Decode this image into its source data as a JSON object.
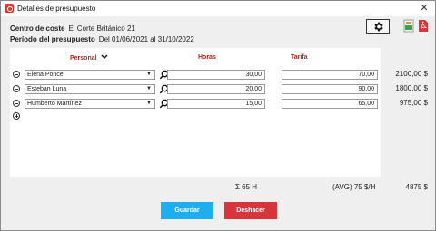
{
  "window": {
    "title": "Detalles de presupuesto"
  },
  "info": {
    "cost_center_label": "Centro de coste",
    "cost_center_value": "El Corte Británico 21",
    "period_label": "Período del presupuesto",
    "period_value": "Del 01/06/2021 al 31/10/2022"
  },
  "toolbar": {
    "settings_icon": "gear-icon",
    "export_icons": [
      "excel-export-icon",
      "pdf-export-icon"
    ]
  },
  "table": {
    "headers": {
      "person": "Personal",
      "hours": "Horas",
      "rate": "Tarifa"
    },
    "rows": [
      {
        "person": "Elena Ponce",
        "hours": "30,00",
        "rate": "70,00",
        "total": "2100,00 $"
      },
      {
        "person": "Esteban Luna",
        "hours": "20,00",
        "rate": "90,00",
        "total": "1800,00 $"
      },
      {
        "person": "Humberto Martínez",
        "hours": "15,00",
        "rate": "65,00",
        "total": "975,00 $"
      }
    ]
  },
  "summary": {
    "hours_total": "Σ 65 H",
    "avg_rate": "(AVG) 75 $/H",
    "grand_total": "4875 $"
  },
  "actions": {
    "save_label": "Guardar",
    "undo_label": "Deshacer"
  },
  "colors": {
    "header_red": "#b0281f",
    "save_blue": "#1eaef0",
    "undo_red": "#d8353a"
  }
}
